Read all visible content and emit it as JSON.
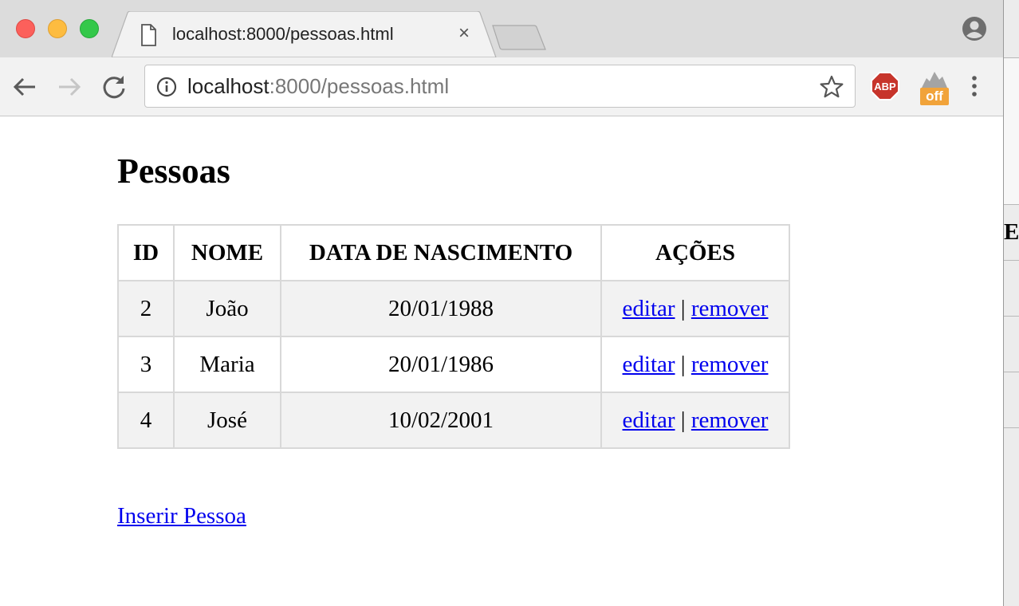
{
  "browser": {
    "tab_title": "localhost:8000/pessoas.html",
    "tab_close": "×",
    "url_host": "localhost",
    "url_rest": ":8000/pessoas.html",
    "extensions": {
      "abp_label": "ABP",
      "off_label": "off"
    },
    "icons": [
      "back-arrow-icon",
      "forward-arrow-icon",
      "reload-icon",
      "info-icon",
      "star-icon",
      "abp-icon",
      "menu-dots-icon",
      "profile-icon",
      "document-icon"
    ]
  },
  "page": {
    "title": "Pessoas",
    "table": {
      "headers": {
        "id": "ID",
        "nome": "NOME",
        "data": "DATA DE NASCIMENTO",
        "acoes": "AÇÕES"
      },
      "rows": [
        {
          "id": "2",
          "nome": "João",
          "data": "20/01/1988",
          "edit": "editar",
          "sep": "|",
          "remove": "remover"
        },
        {
          "id": "3",
          "nome": "Maria",
          "data": "20/01/1986",
          "edit": "editar",
          "sep": "|",
          "remove": "remover"
        },
        {
          "id": "4",
          "nome": "José",
          "data": "10/02/2001",
          "edit": "editar",
          "sep": "|",
          "remove": "remover"
        }
      ]
    },
    "insert_link": "Inserir Pessoa"
  },
  "background_window": {
    "visible_text": "EN"
  },
  "colors": {
    "link": "#0000ee",
    "row_stripe": "#f2f2f2",
    "table_border": "#d8d8d8"
  }
}
